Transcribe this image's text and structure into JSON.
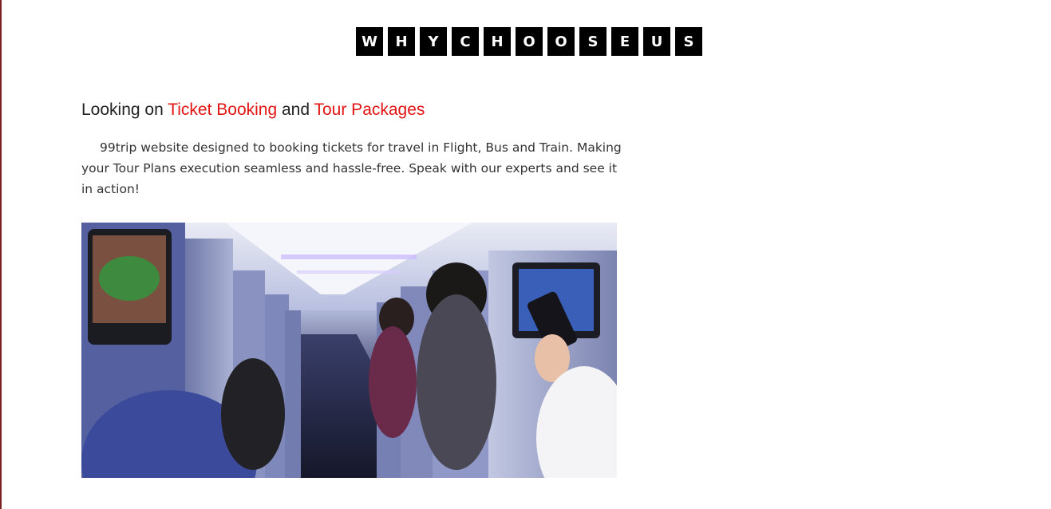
{
  "heading": {
    "letters": [
      "W",
      "H",
      "Y",
      "C",
      "H",
      "O",
      "O",
      "S",
      "E",
      "U",
      "S"
    ]
  },
  "intro": {
    "prefix": "Looking on ",
    "highlight1": "Ticket Booking",
    "middle": " and ",
    "highlight2": "Tour Packages"
  },
  "description": "99trip website designed to booking tickets for travel in Flight, Bus and Train. Making your Tour Plans execution seamless and hassle-free. Speak with our experts and see it in action!",
  "image": {
    "icon": "airplane-cabin-photo"
  },
  "colors": {
    "accent": "#e31414",
    "heading_box": "#000000",
    "border": "#7a1f1f"
  }
}
